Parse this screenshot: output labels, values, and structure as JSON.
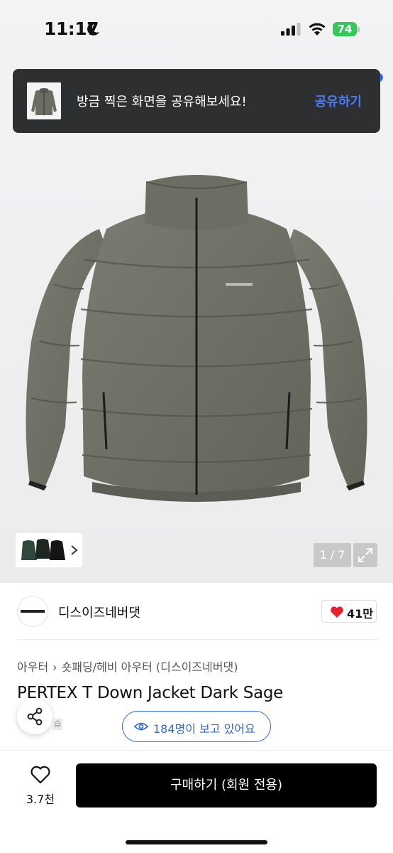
{
  "status_bar": {
    "time": "11:17",
    "battery": "74",
    "icons": [
      "moon-icon",
      "signal-icon",
      "wifi-icon",
      "battery-icon"
    ],
    "battery_color": "#35c759"
  },
  "toast": {
    "message": "방금 찍은 화면을 공유해보세요!",
    "action": "공유하기",
    "action_color": "#4a7cf7"
  },
  "gallery": {
    "counter": "1 / 7",
    "image": "dark sage down jacket",
    "thumbnail_icons": [
      "jacket-thumbnail",
      "chevron-right-icon"
    ],
    "expand_icon": "expand-icon"
  },
  "shop": {
    "name": "디스이즈네버댓",
    "likes": "41만",
    "logo_icon": "shop-logo"
  },
  "product": {
    "breadcrumb": [
      "아우터",
      "숏패딩/헤비 아우터",
      "(디스이즈네버댓)"
    ],
    "title": "PERTEX T Down Jacket Dark Sage",
    "viewers": "184명이 보고 있어요",
    "accent_color": "#3468d9"
  },
  "bottom_bar": {
    "wish_count": "3.7천",
    "buy_label": "구매하기 (회원 전용)"
  }
}
